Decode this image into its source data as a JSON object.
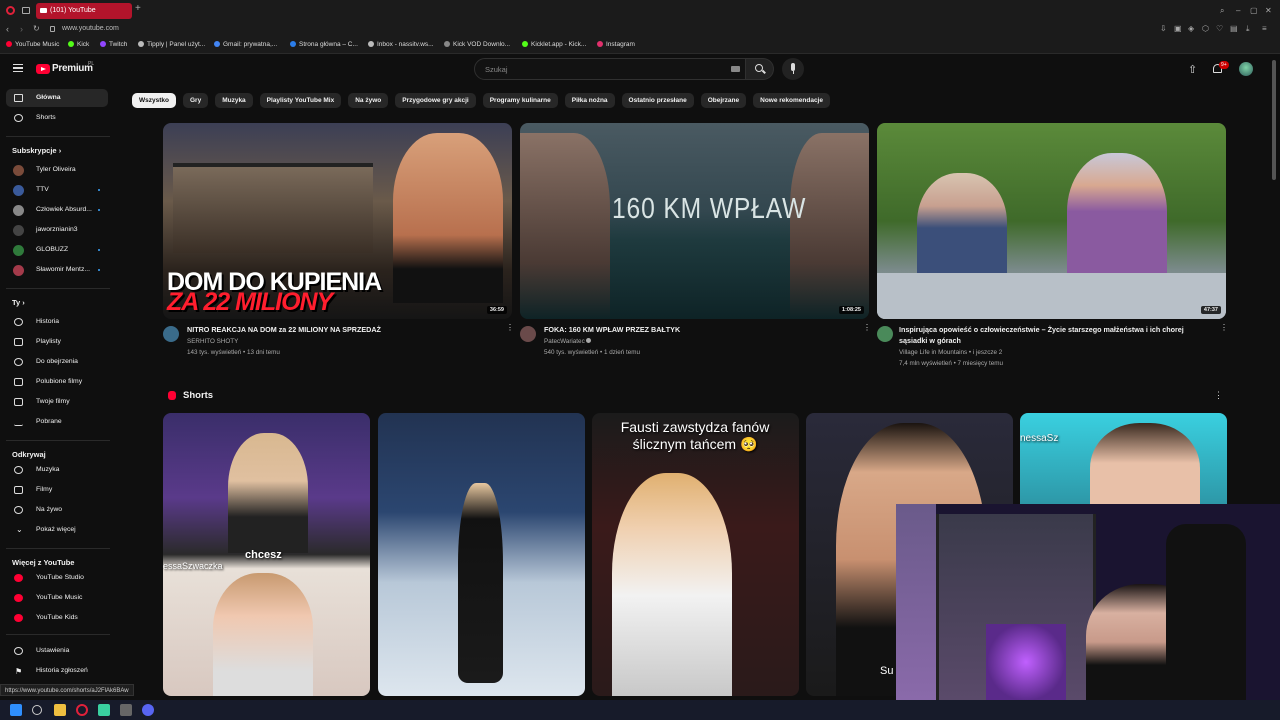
{
  "browser": {
    "tab_title": "(101) YouTube",
    "url": "www.youtube.com",
    "bookmarks": [
      "YouTube Music",
      "Kick",
      "Twitch",
      "Tipply | Panel użyt...",
      "Gmail: prywatna,...",
      "Strona główna – C...",
      "Inbox - nassitv.ws...",
      "Kick VOD Downlo...",
      "Kicklet.app - Kick...",
      "Instagram"
    ],
    "status_url": "https://www.youtube.com/shorts/aJ2FlAk6BAw"
  },
  "header": {
    "logo": "Premium",
    "logo_country": "PL",
    "search_placeholder": "Szukaj",
    "notification_count": "9+"
  },
  "chips": [
    "Wszystko",
    "Gry",
    "Muzyka",
    "Playlisty YouTube Mix",
    "Na żywo",
    "Przygodowe gry akcji",
    "Programy kulinarne",
    "Piłka nożna",
    "Ostatnio przesłane",
    "Obejrzane",
    "Nowe rekomendacje"
  ],
  "sidebar": {
    "main": [
      {
        "label": "Główna",
        "icon": "home-icon"
      },
      {
        "label": "Shorts",
        "icon": "shorts-icon"
      }
    ],
    "subscriptions_header": "Subskrypcje",
    "subscriptions": [
      {
        "label": "Tyler Oliveira",
        "color": "#7a4b3a"
      },
      {
        "label": "TTV",
        "color": "#3a5a9a"
      },
      {
        "label": "Człowiek Absurd...",
        "color": "#888888"
      },
      {
        "label": "jaworznianin3",
        "color": "#444444"
      },
      {
        "label": "GLOBUZZ",
        "color": "#2f7a3b"
      },
      {
        "label": "Sławomir Mentz...",
        "color": "#a33a4a"
      }
    ],
    "you_header": "Ty",
    "you": [
      {
        "label": "Historia",
        "icon": "history-icon"
      },
      {
        "label": "Playlisty",
        "icon": "playlist-icon"
      },
      {
        "label": "Do obejrzenia",
        "icon": "watch-later-icon"
      },
      {
        "label": "Polubione filmy",
        "icon": "like-icon"
      },
      {
        "label": "Twoje filmy",
        "icon": "your-videos-icon"
      },
      {
        "label": "Pobrane",
        "icon": "download-icon"
      }
    ],
    "explore_header": "Odkrywaj",
    "explore": [
      {
        "label": "Muzyka",
        "icon": "music-icon"
      },
      {
        "label": "Filmy",
        "icon": "movies-icon"
      },
      {
        "label": "Na żywo",
        "icon": "live-icon"
      },
      {
        "label": "Pokaż więcej",
        "icon": "chevron-down-icon"
      }
    ],
    "more_header": "Więcej z YouTube",
    "more": [
      {
        "label": "YouTube Studio"
      },
      {
        "label": "YouTube Music"
      },
      {
        "label": "YouTube Kids"
      }
    ],
    "settings": [
      {
        "label": "Ustawienia",
        "icon": "gear-icon"
      },
      {
        "label": "Historia zgłoszeń",
        "icon": "flag-icon"
      }
    ]
  },
  "videos": [
    {
      "title": "NITRO REAKCJA NA DOM za 22 MILIONY NA SPRZEDAŻ",
      "channel": "SERHITO SHOTY",
      "meta": "143 tys. wyświetleń • 13 dni temu",
      "duration": "36:59",
      "overlay_line1": "DOM DO KUPIENIA",
      "overlay_line2": "ZA 22 MILIONY"
    },
    {
      "title": "FOKA: 160 KM WPŁAW PRZEZ BAŁTYK",
      "channel": "PatecWariatec",
      "meta": "540 tys. wyświetleń • 1 dzień temu",
      "duration": "1:08:25",
      "overlay_line1": "160 KM WPŁAW"
    },
    {
      "title_line1": "Inspirująca opowieść o człowieczeństwie – Życie starszego małżeństwa i ich chorej",
      "title_line2": "sąsiadki w górach",
      "channel": "Village Life in Mountains • i jeszcze 2",
      "meta": "7,4 mln wyświetleń • 7 miesięcy temu",
      "duration": "47:37"
    }
  ],
  "shorts": {
    "header": "Shorts",
    "items": [
      {
        "caption": "chcesz",
        "watermark": "essaSzwaczka"
      },
      {
        "caption": ""
      },
      {
        "caption": "Fausti zawstydza fanów ślicznym tańcem 🥺"
      },
      {
        "caption": "Su"
      },
      {
        "caption": "nessaSz"
      }
    ]
  }
}
